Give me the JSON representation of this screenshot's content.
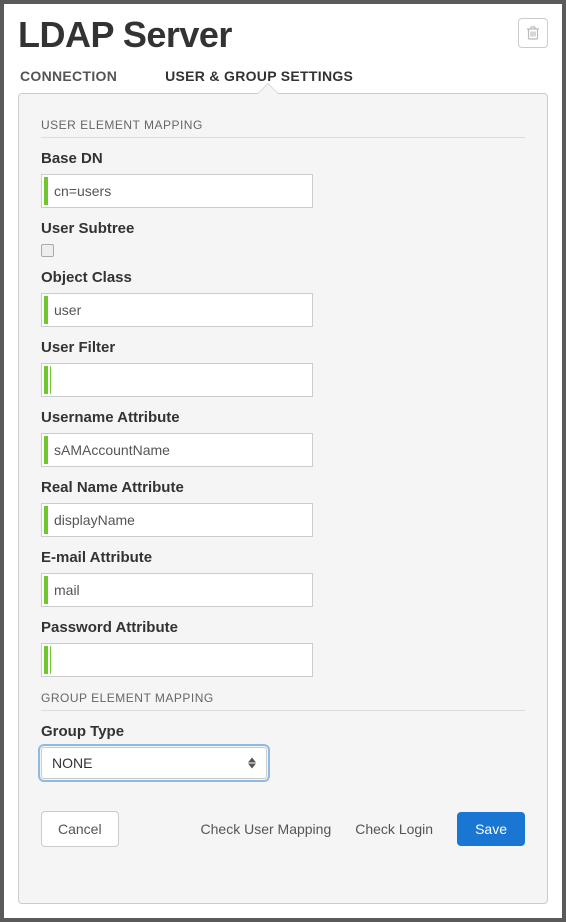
{
  "header": {
    "title": "LDAP Server"
  },
  "tabs": {
    "connection": "CONNECTION",
    "userGroup": "USER & GROUP SETTINGS"
  },
  "sections": {
    "userMapping": "USER ELEMENT MAPPING",
    "groupMapping": "GROUP ELEMENT MAPPING"
  },
  "fields": {
    "baseDn": {
      "label": "Base DN",
      "value": "cn=users"
    },
    "userSubtree": {
      "label": "User Subtree",
      "checked": false
    },
    "objectClass": {
      "label": "Object Class",
      "value": "user"
    },
    "userFilter": {
      "label": "User Filter",
      "value": ""
    },
    "usernameAttr": {
      "label": "Username Attribute",
      "value": "sAMAccountName"
    },
    "realNameAttr": {
      "label": "Real Name Attribute",
      "value": "displayName"
    },
    "emailAttr": {
      "label": "E-mail Attribute",
      "value": "mail"
    },
    "passwordAttr": {
      "label": "Password Attribute",
      "value": ""
    },
    "groupType": {
      "label": "Group Type",
      "value": "NONE"
    }
  },
  "footer": {
    "cancel": "Cancel",
    "checkUserMapping": "Check User Mapping",
    "checkLogin": "Check Login",
    "save": "Save"
  }
}
